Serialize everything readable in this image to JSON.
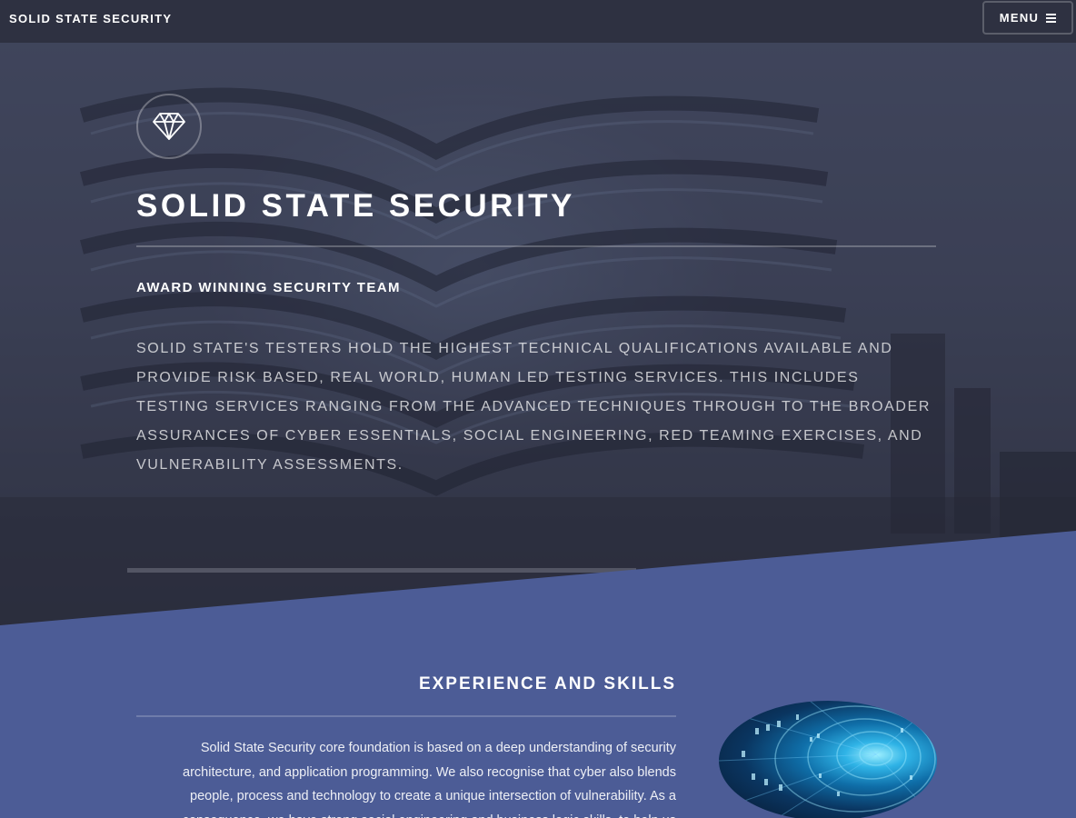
{
  "header": {
    "brand": "SOLID STATE SECURITY",
    "menu_label": "MENU"
  },
  "hero": {
    "logo_icon": "diamond-icon",
    "title": "SOLID STATE SECURITY",
    "subtitle": "AWARD WINNING SECURITY TEAM",
    "body": "SOLID STATE'S TESTERS HOLD THE HIGHEST TECHNICAL QUALIFICATIONS AVAILABLE AND PROVIDE RISK BASED, REAL WORLD, HUMAN LED TESTING SERVICES. THIS INCLUDES TESTING SERVICES RANGING FROM THE ADVANCED TECHNIQUES THROUGH TO THE BROADER ASSURANCES OF CYBER ESSENTIALS, SOCIAL ENGINEERING, RED TEAMING EXERCISES, AND VULNERABILITY ASSESSMENTS."
  },
  "experience": {
    "title": "EXPERIENCE AND SKILLS",
    "body": "Solid State Security core foundation is based on a deep understanding of security architecture, and application programming. We also recognise that cyber also blends people, process and technology to create a unique intersection of vulnerability. As a consequence, we have strong social engineering and business logic skills, to help us address"
  },
  "colors": {
    "header_bg": "#2e3141",
    "section_bg": "#4c5c96"
  }
}
